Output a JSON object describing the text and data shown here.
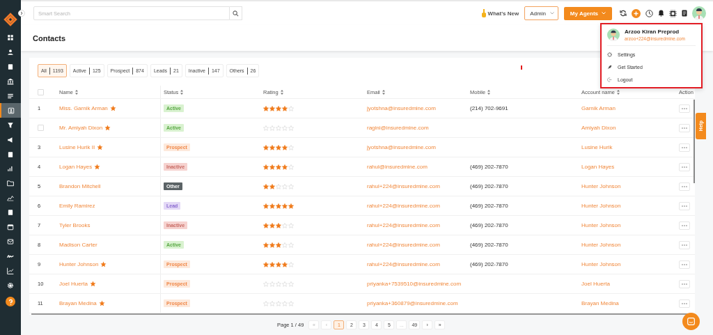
{
  "topbar": {
    "search": {
      "placeholder": "Smart Search"
    },
    "whats_new": "What's New",
    "role_select": {
      "value": "Admin"
    },
    "agents_button": "My Agents"
  },
  "sidebar": {
    "items": [
      {
        "selected": false
      },
      {
        "selected": false
      },
      {
        "selected": false
      },
      {
        "selected": false
      },
      {
        "selected": false
      },
      {
        "selected": true
      },
      {
        "selected": false
      },
      {
        "selected": false
      },
      {
        "selected": false
      },
      {
        "selected": false
      },
      {
        "selected": false
      },
      {
        "selected": false
      },
      {
        "selected": false
      },
      {
        "selected": false
      },
      {
        "selected": false
      },
      {
        "selected": false
      },
      {
        "selected": false
      },
      {
        "selected": false
      }
    ]
  },
  "page_title": "Contacts",
  "filters": [
    {
      "label": "All",
      "count": "1193",
      "selected": true
    },
    {
      "label": "Active",
      "count": "125",
      "selected": false
    },
    {
      "label": "Prospect",
      "count": "874",
      "selected": false
    },
    {
      "label": "Leads",
      "count": "21",
      "selected": false
    },
    {
      "label": "Inactive",
      "count": "147",
      "selected": false
    },
    {
      "label": "Others",
      "count": "26",
      "selected": false
    }
  ],
  "table": {
    "select_all": {
      "checked": false
    },
    "columns": [
      "Name",
      "Status",
      "Rating",
      "Email",
      "Mobile",
      "Account name",
      "Action"
    ],
    "rows": [
      {
        "number": "1",
        "name": "Miss. Garnik Arman",
        "favorite": true,
        "status": {
          "label": "Active",
          "kind": "active"
        },
        "stars": 4,
        "email": "jyotshna@insuredmine.com",
        "mobile": "(214) 702-9691",
        "account_name": "Garnik Arman"
      },
      {
        "checked": false,
        "name": "Mr. Amiyah Dixon",
        "favorite": true,
        "status": {
          "label": "Active",
          "kind": "active"
        },
        "stars": 0,
        "email": "ragini@insuredmine.com",
        "account_name": "Amiyah Dixon"
      },
      {
        "number": "3",
        "name": "Lusine Hurik  II",
        "favorite": true,
        "status": {
          "label": "Prospect",
          "kind": "prospect"
        },
        "stars": 4,
        "email": "jyotshna@insuredmine.com",
        "account_name": "Lusine Hurik"
      },
      {
        "number": "4",
        "name": "Logan Hayes",
        "favorite": true,
        "status": {
          "label": "Inactive",
          "kind": "inactive"
        },
        "stars": 4,
        "email": "rahul@insuredmine.com",
        "mobile": "(469) 202-7870",
        "account_name": "Logan Hayes"
      },
      {
        "number": "5",
        "name": "Brandon Mitchell",
        "favorite": false,
        "status": {
          "label": "Other",
          "kind": "other"
        },
        "stars": 2,
        "email": "rahul+224@insuredmine.com",
        "mobile": "(469) 202-7870",
        "account_name": "Hunter Johnson"
      },
      {
        "number": "6",
        "name": "Emily Ramirez",
        "favorite": false,
        "status": {
          "label": "Lead",
          "kind": "lead"
        },
        "stars": 5,
        "email": "rahul+224@insuredmine.com",
        "mobile": "(469) 202-7870",
        "account_name": "Hunter Johnson"
      },
      {
        "number": "7",
        "name": "Tyler Brooks",
        "favorite": false,
        "status": {
          "label": "Inactive",
          "kind": "inactive"
        },
        "stars": 3,
        "email": "rahul+224@insuredmine.com",
        "mobile": "(469) 202-7870",
        "account_name": "Hunter Johnson"
      },
      {
        "number": "8",
        "name": "Madison Carter",
        "favorite": false,
        "status": {
          "label": "Active",
          "kind": "active"
        },
        "stars": 3,
        "email": "rahul+224@insuredmine.com",
        "mobile": "(469) 202-7870",
        "account_name": "Hunter Johnson"
      },
      {
        "number": "9",
        "name": "Hunter Johnson",
        "favorite": true,
        "status": {
          "label": "Prospect",
          "kind": "prospect"
        },
        "stars": 4,
        "email": "rahul+224@insuredmine.com",
        "mobile": "(469) 202-7870",
        "account_name": "Hunter Johnson"
      },
      {
        "number": "10",
        "name": "Joel Huerta",
        "favorite": true,
        "status": {
          "label": "Prospect",
          "kind": "prospect"
        },
        "stars": 0,
        "email": "priyanka+7539510@insuredmine.com",
        "account_name": "Joel Huerta"
      },
      {
        "number": "11",
        "name": "Brayan Medina",
        "favorite": true,
        "status": {
          "label": "Prospect",
          "kind": "prospect"
        },
        "stars": 0,
        "email": "priyanka+360879@insuredmine.com",
        "account_name": "Brayan Medina"
      }
    ]
  },
  "pagination": {
    "label": "Page 1 / 49",
    "buttons": [
      {
        "label": "«",
        "disabled": true,
        "selected": false
      },
      {
        "label": "‹",
        "disabled": true,
        "selected": false
      },
      {
        "label": "1",
        "disabled": false,
        "selected": true
      },
      {
        "label": "2",
        "disabled": false,
        "selected": false
      },
      {
        "label": "3",
        "disabled": false,
        "selected": false
      },
      {
        "label": "4",
        "disabled": false,
        "selected": false
      },
      {
        "label": "5",
        "disabled": false,
        "selected": false
      },
      {
        "label": "...",
        "disabled": true,
        "selected": false
      },
      {
        "label": "49",
        "disabled": false,
        "selected": false
      },
      {
        "label": "›",
        "disabled": false,
        "selected": false
      },
      {
        "label": "»",
        "disabled": false,
        "selected": false
      }
    ]
  },
  "user_menu": {
    "name": "Arzoo Kiran Preprod",
    "email": "arzoo+224@insuredmine.com",
    "items": [
      {
        "label": "Settings",
        "kind": "settings"
      },
      {
        "label": "Get Started",
        "kind": "start"
      },
      {
        "label": "Logout",
        "kind": "logout"
      }
    ]
  },
  "help_tab": "Help"
}
